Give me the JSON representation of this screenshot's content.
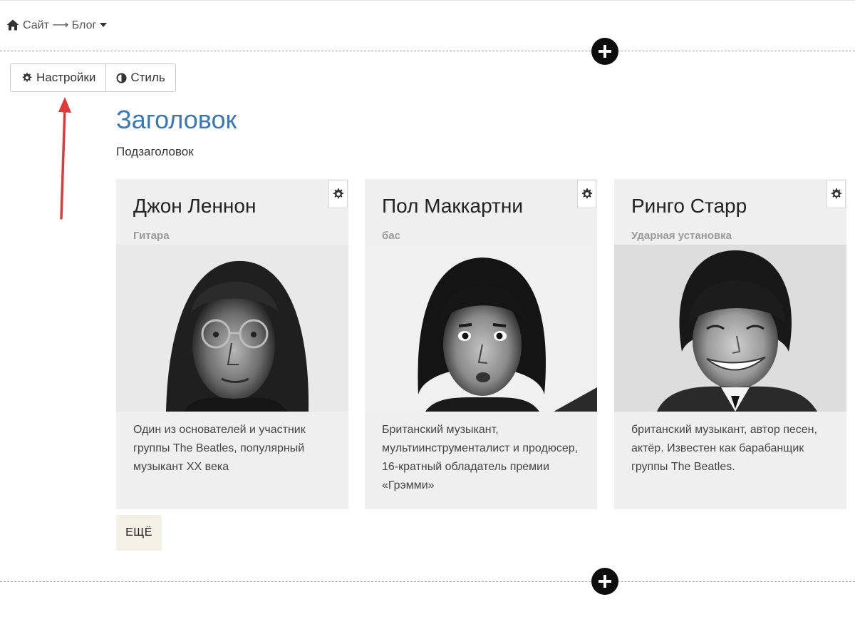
{
  "breadcrumb": {
    "text": "Сайт ⟶ Блог"
  },
  "toolbar": {
    "settings_label": "Настройки",
    "style_label": "Стиль"
  },
  "section": {
    "title": "Заголовок",
    "subtitle": "Подзаголовок"
  },
  "cards": [
    {
      "name": "Джон Леннон",
      "role": "Гитара",
      "description": "Один из основателей и участник группы The Beatles, популярный музыкант XX века"
    },
    {
      "name": "Пол Маккартни",
      "role": "бас",
      "description": "Британский музыкант, мультиинструменталист и продюсер, 16-кратный обладатель премии «Грэмми»"
    },
    {
      "name": "Ринго Старр",
      "role": "Ударная установка",
      "description": "британский музыкант, автор песен, актёр. Известен как барабанщик группы The Beatles."
    }
  ],
  "more_button": {
    "label": "ЕЩЁ"
  },
  "colors": {
    "title": "#3a78b5",
    "card_bg": "#efefef",
    "more_bg": "#f3f1e6",
    "arrow": "#e0393b",
    "add_button": "#0d0d0d"
  },
  "icons": {
    "home": "home-icon",
    "caret": "caret-down-icon",
    "gear": "gear-icon",
    "contrast": "contrast-icon",
    "plus": "plus-icon"
  }
}
